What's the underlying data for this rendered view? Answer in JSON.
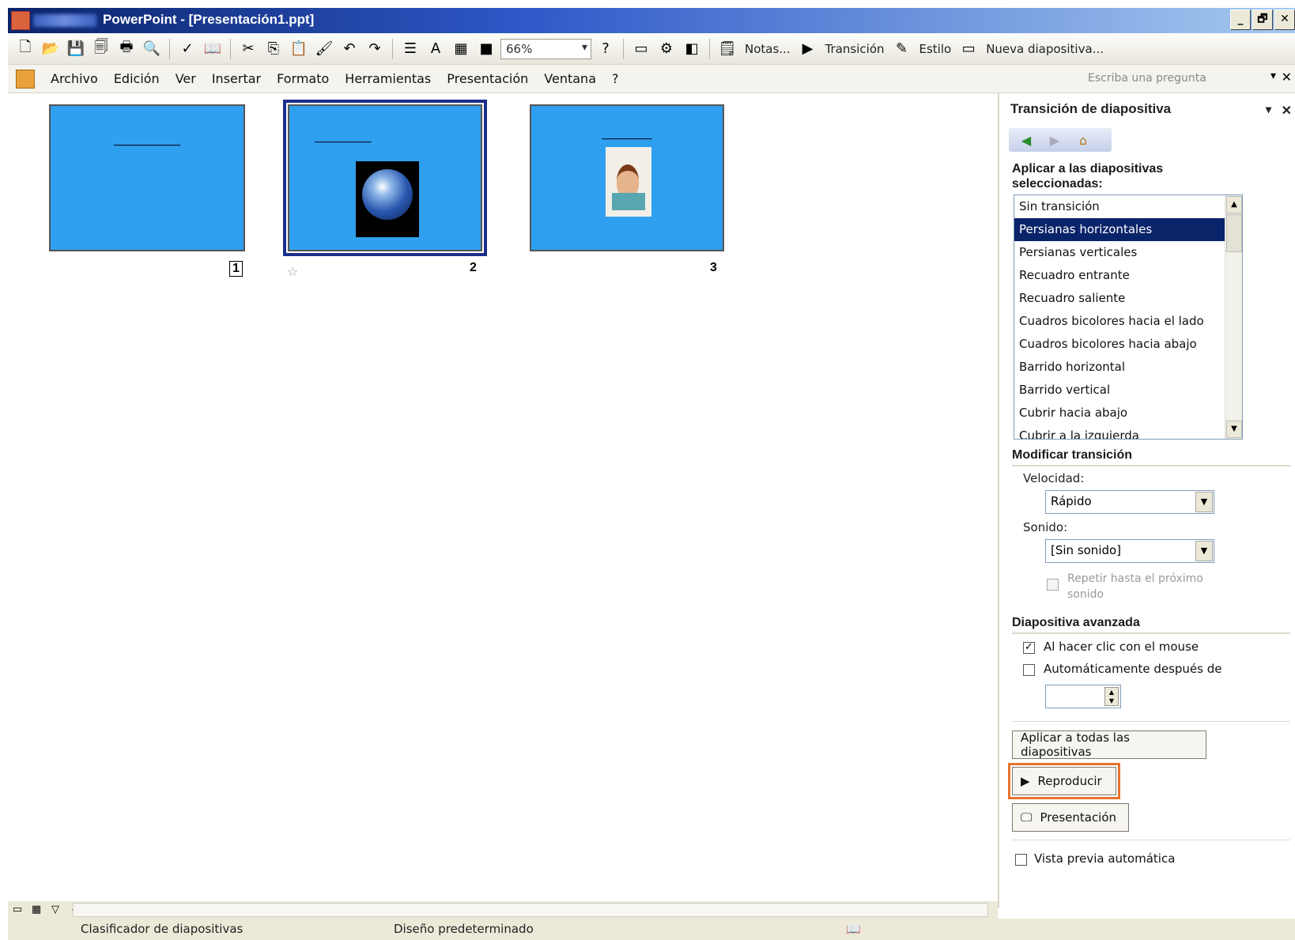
{
  "window": {
    "title": "PowerPoint - [Presentación1.ppt]",
    "buttons": [
      "_",
      "🗗",
      "✕"
    ]
  },
  "toolbar": {
    "zoom": "66%",
    "notes_label": "Notas...",
    "transition_label": "Transición",
    "style_label": "Estilo",
    "new_slide_label": "Nueva diapositiva..."
  },
  "menu": {
    "items": [
      "Archivo",
      "Edición",
      "Ver",
      "Insertar",
      "Formato",
      "Herramientas",
      "Presentación",
      "Ventana",
      "?"
    ],
    "ask_placeholder": "Escriba una pregunta"
  },
  "slides": [
    {
      "number": "1"
    },
    {
      "number": "2"
    },
    {
      "number": "3"
    }
  ],
  "taskpane": {
    "title": "Transición de diapositiva",
    "apply_heading": "Aplicar a las diapositivas seleccionadas:",
    "transitions": [
      "Sin transición",
      "Persianas horizontales",
      "Persianas verticales",
      "Recuadro entrante",
      "Recuadro saliente",
      "Cuadros bicolores hacia el lado",
      "Cuadros bicolores hacia abajo",
      "Barrido horizontal",
      "Barrido vertical",
      "Cubrir hacia abajo",
      "Cubrir a la izquierda"
    ],
    "selected_transition": "Persianas horizontales",
    "modify_heading": "Modificar transición",
    "speed_label": "Velocidad:",
    "speed_value": "Rápido",
    "sound_label": "Sonido:",
    "sound_value": "[Sin sonido]",
    "repeat_label": "Repetir hasta el próximo sonido",
    "advance_heading": "Diapositiva avanzada",
    "on_click_label": "Al hacer clic con el mouse",
    "on_click_checked": true,
    "auto_label": "Automáticamente después de",
    "auto_checked": false,
    "apply_all_button": "Aplicar a todas las diapositivas",
    "play_button": "Reproducir",
    "slideshow_button": "Presentación",
    "preview_label": "Vista previa automática"
  },
  "status": {
    "view": "Clasificador de diapositivas",
    "design": "Diseño predeterminado"
  }
}
